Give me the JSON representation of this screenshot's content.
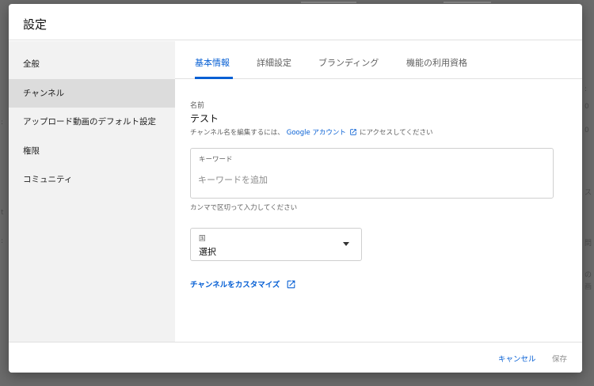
{
  "dialog": {
    "title": "設定"
  },
  "sidebar": {
    "items": [
      {
        "label": "全般",
        "active": false
      },
      {
        "label": "チャンネル",
        "active": true
      },
      {
        "label": "アップロード動画のデフォルト設定",
        "active": false
      },
      {
        "label": "権限",
        "active": false
      },
      {
        "label": "コミュニティ",
        "active": false
      }
    ]
  },
  "tabs": [
    {
      "label": "基本情報",
      "active": true
    },
    {
      "label": "詳細設定",
      "active": false
    },
    {
      "label": "ブランディング",
      "active": false
    },
    {
      "label": "機能の利用資格",
      "active": false
    }
  ],
  "basic": {
    "name_label": "名前",
    "name_value": "テスト",
    "name_help_prefix": "チャンネル名を編集するには、",
    "name_help_link": "Google アカウント",
    "name_help_suffix": "にアクセスしてください",
    "keywords_label": "キーワード",
    "keywords_placeholder": "キーワードを追加",
    "keywords_value": "",
    "keywords_help": "カンマで区切って入力してください",
    "country_label": "国",
    "country_value": "選択",
    "customize_label": "チャンネルをカスタマイズ"
  },
  "footer": {
    "cancel_label": "キャンセル",
    "save_label": "保存"
  },
  "colors": {
    "accent": "#065fd4",
    "sidebar_bg": "#f2f2f2",
    "sidebar_active_bg": "#dcdcdc",
    "backdrop": "#6b6b6b"
  },
  "icons": {
    "external_link": "open-in-new-icon",
    "dropdown": "caret-down-icon"
  }
}
